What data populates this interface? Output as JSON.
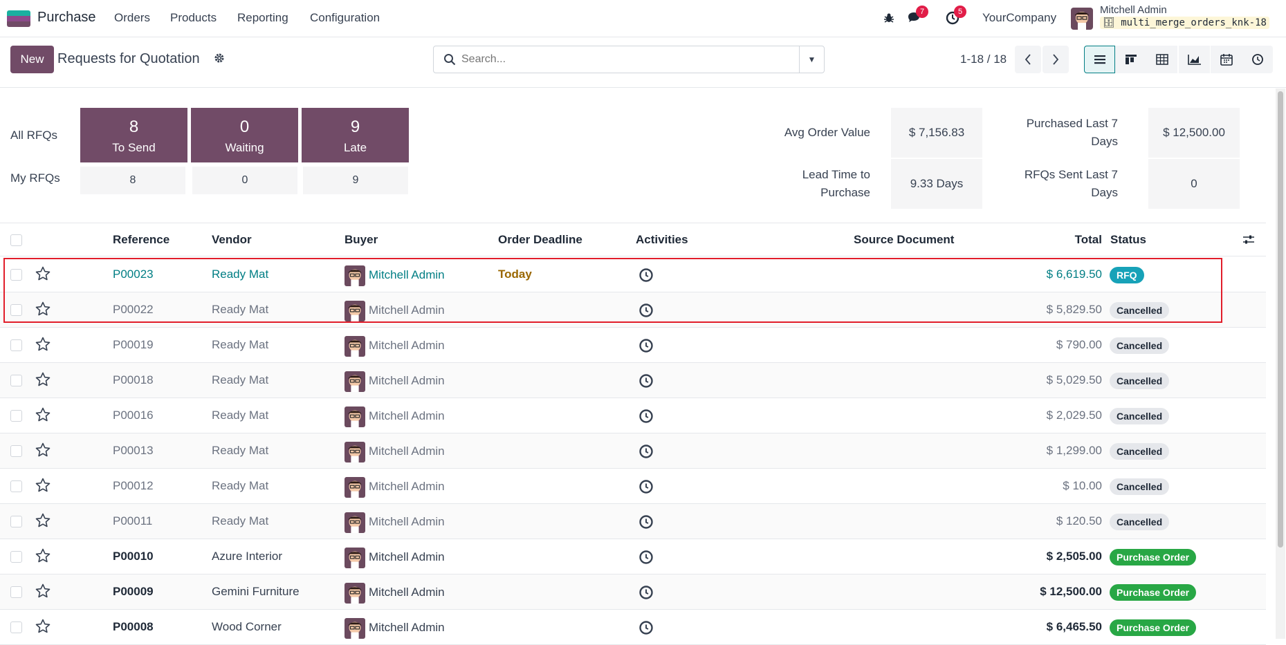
{
  "nav": {
    "app_name": "Purchase",
    "menus": [
      "Orders",
      "Products",
      "Reporting",
      "Configuration"
    ],
    "messages_count": "7",
    "activities_count": "5",
    "company": "YourCompany",
    "user_name": "Mitchell Admin",
    "database": "multi_merge_orders_knk-18"
  },
  "control": {
    "new_label": "New",
    "title": "Requests for Quotation",
    "search_placeholder": "Search...",
    "pager": "1-18 / 18",
    "views": [
      "list-view-icon",
      "kanban-view-icon",
      "pivot-view-icon",
      "graph-view-icon",
      "calendar-view-icon",
      "activity-view-icon"
    ]
  },
  "dashboard": {
    "all_label": "All RFQs",
    "my_label": "My RFQs",
    "tiles": [
      {
        "num": "8",
        "label": "To Send",
        "mine": "8"
      },
      {
        "num": "0",
        "label": "Waiting",
        "mine": "0"
      },
      {
        "num": "9",
        "label": "Late",
        "mine": "9"
      }
    ],
    "stats": {
      "avg_order_label": "Avg Order Value",
      "avg_order_value": "$ 7,156.83",
      "purchased_label_1": "Purchased Last 7",
      "purchased_label_2": "Days",
      "purchased_value": "$ 12,500.00",
      "lead_label_1": "Lead Time to",
      "lead_label_2": "Purchase",
      "lead_value": "9.33 Days",
      "sent_label_1": "RFQs Sent Last 7",
      "sent_label_2": "Days",
      "sent_value": "0"
    }
  },
  "table": {
    "headers": {
      "reference": "Reference",
      "vendor": "Vendor",
      "buyer": "Buyer",
      "deadline": "Order Deadline",
      "activities": "Activities",
      "source": "Source Document",
      "total": "Total",
      "status": "Status"
    },
    "rows": [
      {
        "ref": "P00023",
        "vendor": "Ready Mat",
        "buyer": "Mitchell Admin",
        "deadline": "Today",
        "total": "$ 6,619.50",
        "status": "RFQ",
        "kind": "rfq"
      },
      {
        "ref": "P00022",
        "vendor": "Ready Mat",
        "buyer": "Mitchell Admin",
        "deadline": "",
        "total": "$ 5,829.50",
        "status": "Cancelled",
        "kind": "cancelled"
      },
      {
        "ref": "P00019",
        "vendor": "Ready Mat",
        "buyer": "Mitchell Admin",
        "deadline": "",
        "total": "$ 790.00",
        "status": "Cancelled",
        "kind": "cancelled"
      },
      {
        "ref": "P00018",
        "vendor": "Ready Mat",
        "buyer": "Mitchell Admin",
        "deadline": "",
        "total": "$ 5,029.50",
        "status": "Cancelled",
        "kind": "cancelled"
      },
      {
        "ref": "P00016",
        "vendor": "Ready Mat",
        "buyer": "Mitchell Admin",
        "deadline": "",
        "total": "$ 2,029.50",
        "status": "Cancelled",
        "kind": "cancelled"
      },
      {
        "ref": "P00013",
        "vendor": "Ready Mat",
        "buyer": "Mitchell Admin",
        "deadline": "",
        "total": "$ 1,299.00",
        "status": "Cancelled",
        "kind": "cancelled"
      },
      {
        "ref": "P00012",
        "vendor": "Ready Mat",
        "buyer": "Mitchell Admin",
        "deadline": "",
        "total": "$ 10.00",
        "status": "Cancelled",
        "kind": "cancelled"
      },
      {
        "ref": "P00011",
        "vendor": "Ready Mat",
        "buyer": "Mitchell Admin",
        "deadline": "",
        "total": "$ 120.50",
        "status": "Cancelled",
        "kind": "cancelled"
      },
      {
        "ref": "P00010",
        "vendor": "Azure Interior",
        "buyer": "Mitchell Admin",
        "deadline": "",
        "total": "$ 2,505.00",
        "status": "Purchase Order",
        "kind": "po"
      },
      {
        "ref": "P00009",
        "vendor": "Gemini Furniture",
        "buyer": "Mitchell Admin",
        "deadline": "",
        "total": "$ 12,500.00",
        "status": "Purchase Order",
        "kind": "po"
      },
      {
        "ref": "P00008",
        "vendor": "Wood Corner",
        "buyer": "Mitchell Admin",
        "deadline": "",
        "total": "$ 6,465.50",
        "status": "Purchase Order",
        "kind": "po"
      }
    ]
  },
  "colors": {
    "brand": "#714b67",
    "link": "#017e84",
    "deadline_today": "#9a6700",
    "highlight": "#e11d2a"
  }
}
